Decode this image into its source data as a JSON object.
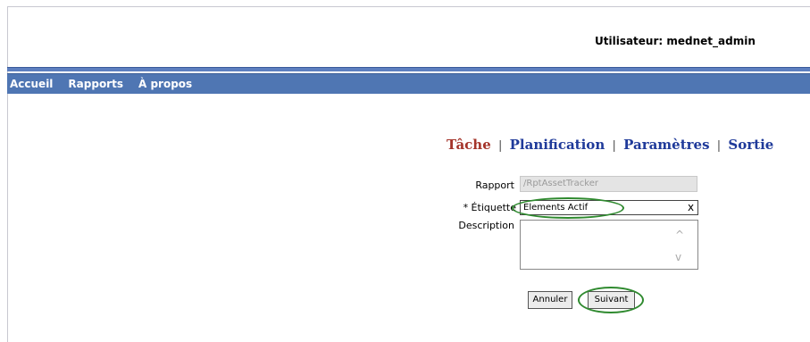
{
  "header": {
    "user_label": "Utilisateur: mednet_admin"
  },
  "nav": {
    "items": [
      "Accueil",
      "Rapports",
      "À propos"
    ]
  },
  "steps": {
    "current": "Tâche",
    "s2": "Planification",
    "s3": "Paramètres",
    "s4": "Sortie",
    "separator": "|"
  },
  "form": {
    "rapport_label": "Rapport",
    "rapport_value": "/RptAssetTracker",
    "etiquette_label": "* Étiquette",
    "etiquette_value": "Elements Actif",
    "clear_symbol": "x",
    "description_label": "Description",
    "description_value": ""
  },
  "buttons": {
    "cancel": "Annuler",
    "next": "Suivant"
  },
  "colors": {
    "navbar": "#4f76b3",
    "current_step": "#a4342a",
    "step_link": "#1f3a9a",
    "highlight_oval": "#2f8a2f"
  },
  "icons": {
    "scroll_up": "chevron-up-icon",
    "scroll_down": "chevron-down-icon"
  }
}
